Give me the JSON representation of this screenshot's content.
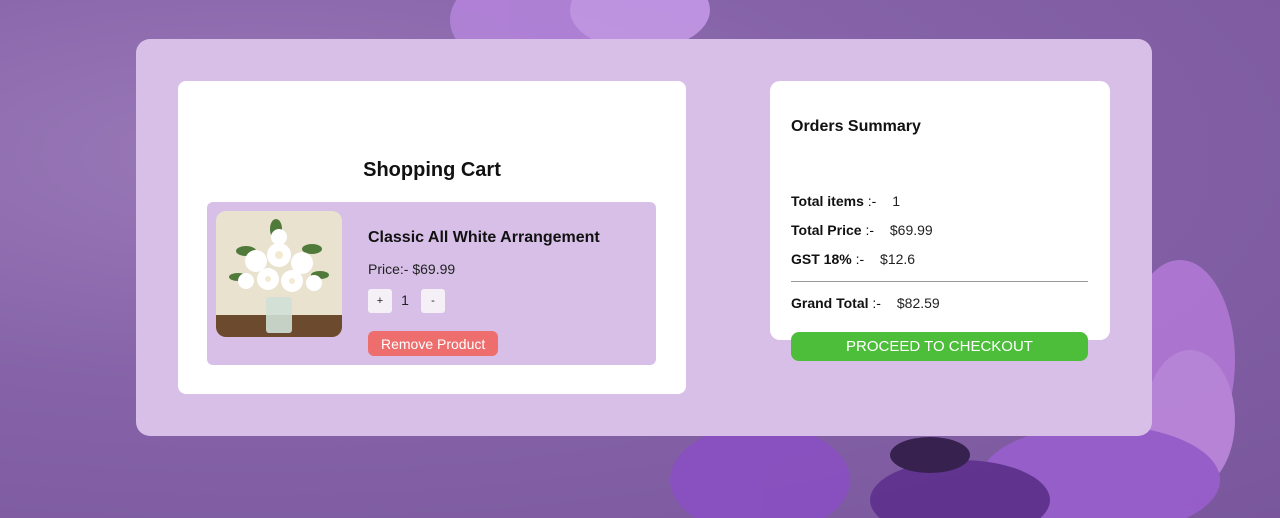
{
  "cart": {
    "title": "Shopping Cart",
    "item": {
      "name": "Classic All White Arrangement",
      "price_label": "Price:- $69.99",
      "plus_label": "+",
      "minus_label": "-",
      "quantity": "1",
      "remove_label": "Remove Product"
    }
  },
  "summary": {
    "title": "Orders Summary",
    "total_items_label": "Total items",
    "total_items_value": "1",
    "total_price_label": "Total Price",
    "total_price_value": "$69.99",
    "gst_label": "GST 18%",
    "gst_value": "$12.6",
    "grand_total_label": "Grand Total",
    "grand_total_value": "$82.59",
    "separator": ":-",
    "checkout_label": "PROCEED TO CHECKOUT"
  },
  "colors": {
    "panel_bg": "#d7bfe8",
    "remove_button": "#ee6e6e",
    "checkout_button": "#4cbe3a",
    "background_flower": "#9b5fd0"
  }
}
